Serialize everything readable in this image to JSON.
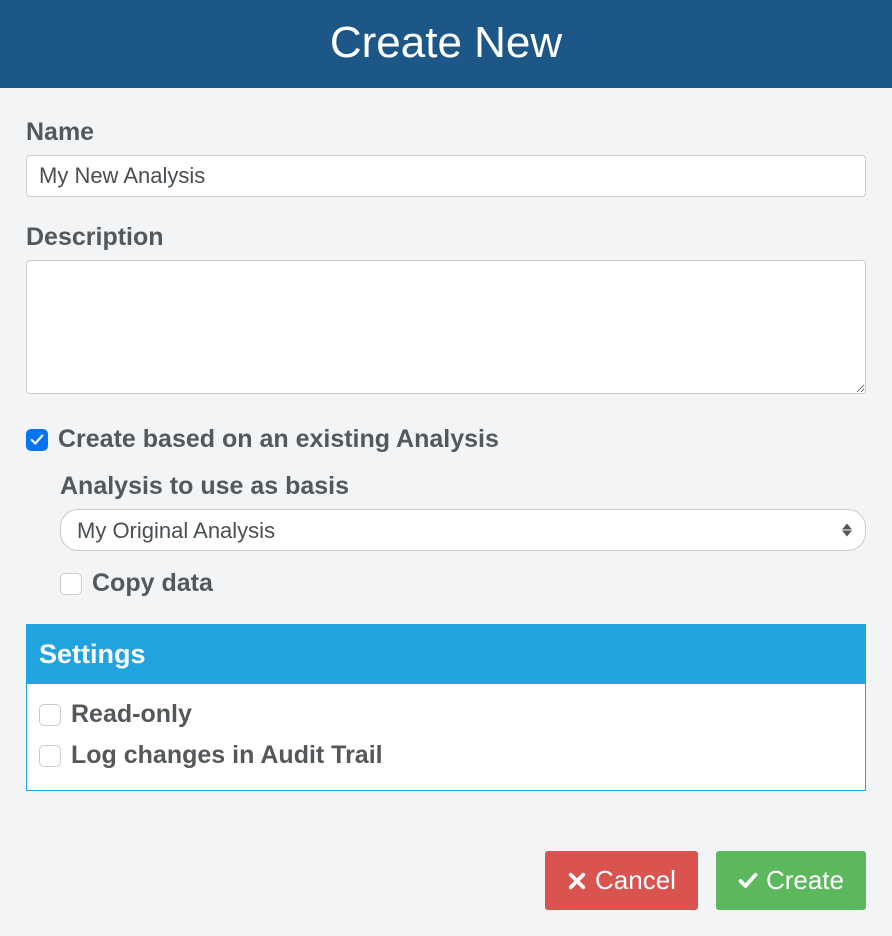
{
  "header": {
    "title": "Create New"
  },
  "fields": {
    "name_label": "Name",
    "name_value": "My New Analysis",
    "description_label": "Description",
    "description_value": ""
  },
  "basis": {
    "checkbox_label": "Create based on an existing Analysis",
    "checkbox_checked": true,
    "analysis_label": "Analysis to use as basis",
    "analysis_selected": "My Original Analysis",
    "copy_data_label": "Copy data",
    "copy_data_checked": false
  },
  "settings": {
    "header": "Settings",
    "readonly_label": "Read-only",
    "readonly_checked": false,
    "audit_label": "Log changes in Audit Trail",
    "audit_checked": false
  },
  "footer": {
    "cancel_label": "Cancel",
    "create_label": "Create"
  }
}
